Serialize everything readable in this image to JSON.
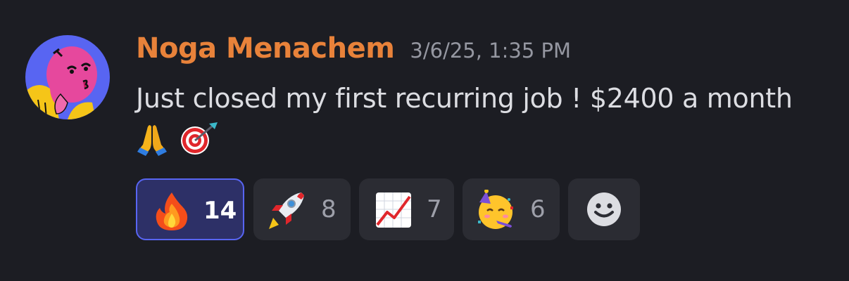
{
  "message": {
    "author": "Noga Menachem",
    "timestamp": "3/6/25, 1:35 PM",
    "text": "Just closed my first recurring job ! $2400 a month",
    "inline_emojis": [
      "folded-hands",
      "direct-hit"
    ],
    "author_color": "#e8823a"
  },
  "reactions": [
    {
      "emoji": "fire",
      "count": "14",
      "active": true
    },
    {
      "emoji": "rocket",
      "count": "8",
      "active": false
    },
    {
      "emoji": "chart-increasing",
      "count": "7",
      "active": false
    },
    {
      "emoji": "partying-face",
      "count": "6",
      "active": false
    }
  ],
  "add_reaction": {
    "icon": "add-reaction-smiley"
  },
  "colors": {
    "background": "#1c1d23",
    "reaction_bg": "#2b2c33",
    "reaction_active_bg": "#2d3067",
    "reaction_active_border": "#5865f2"
  }
}
